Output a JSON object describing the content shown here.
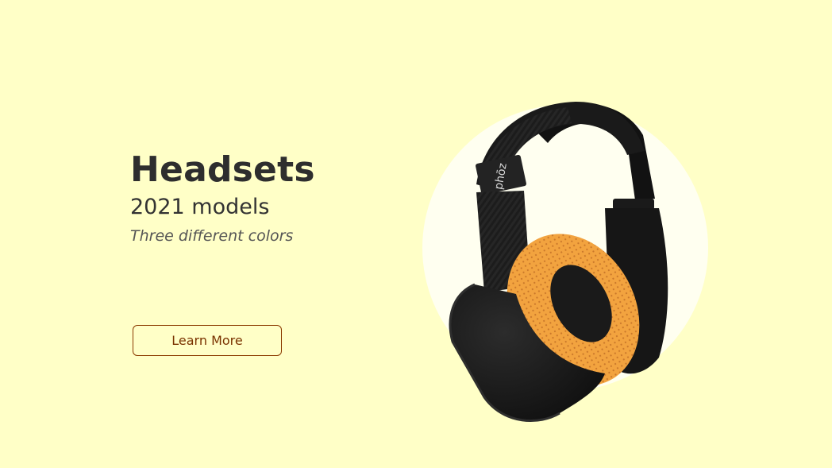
{
  "hero": {
    "title": "Headsets",
    "subtitle": "2021 models",
    "tagline": "Three different colors",
    "cta_label": "Learn More"
  },
  "product": {
    "brand_mark": "phōz",
    "image_label": "headphones-image"
  },
  "colors": {
    "background": "#ffffc7",
    "circle": "#fffff0",
    "title_text": "#2e2e2e",
    "cta_border": "#8b3a00",
    "cta_text": "#7a3300",
    "headband": "#1e1e1e",
    "earpad": "#f0a040"
  }
}
